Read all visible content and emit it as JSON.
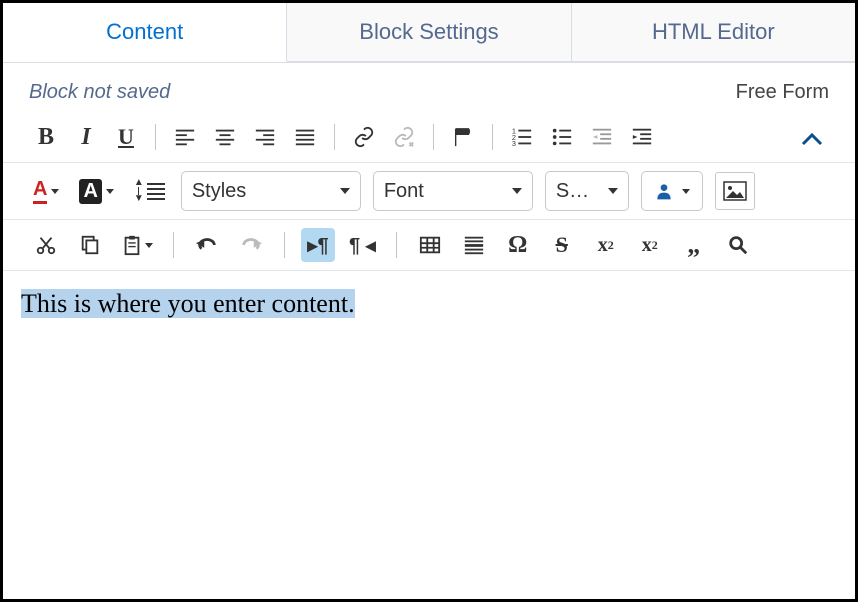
{
  "tabs": {
    "content": "Content",
    "block_settings": "Block Settings",
    "html_editor": "HTML Editor",
    "active": "content"
  },
  "status": {
    "left": "Block not saved",
    "right": "Free Form"
  },
  "toolbar_row1": {
    "bold": "B",
    "italic": "I",
    "underline": "U"
  },
  "dropdowns": {
    "styles": "Styles",
    "font": "Font",
    "size_short": "S…"
  },
  "text_color_letter": "A",
  "bg_color_letter": "A",
  "content_text": "This is where you enter content.",
  "icons": {
    "pilcrow_left": "▸¶",
    "pilcrow_right": "¶ ◂",
    "omega": "Ω",
    "strikethrough": "S",
    "subscript": "x",
    "sub_small": "2",
    "superscript": "x",
    "sup_small": "2"
  }
}
